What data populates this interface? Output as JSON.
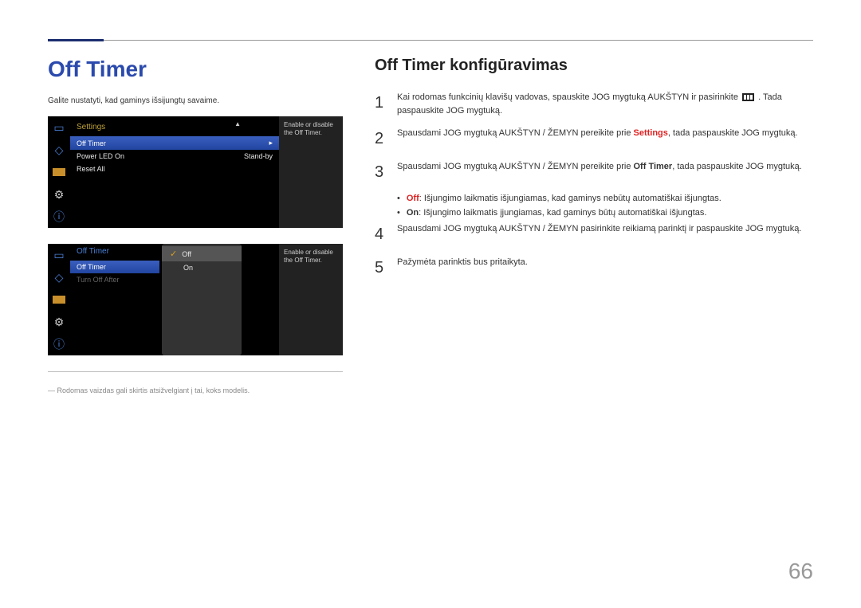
{
  "page_number": "66",
  "left": {
    "title": "Off Timer",
    "desc": "Galite nustatyti, kad gaminys išsijungtų savaime.",
    "note_prefix": "―",
    "note": "Rodomas vaizdas gali skirtis atsižvelgiant į tai, koks modelis."
  },
  "osd1": {
    "title": "Settings",
    "hint_line1": "Enable or disable",
    "hint_line2": "the Off Timer.",
    "rows": [
      {
        "label": "Off Timer",
        "value": "",
        "selected": true,
        "arrow": true
      },
      {
        "label": "Power LED On",
        "value": "Stand-by"
      },
      {
        "label": "Reset All",
        "value": ""
      }
    ]
  },
  "osd2": {
    "title": "Off Timer",
    "hint_line1": "Enable or disable",
    "hint_line2": "the Off Timer.",
    "rows": [
      {
        "label": "Off Timer",
        "selected": true
      },
      {
        "label": "Turn Off After",
        "dim": true
      }
    ],
    "submenu": [
      {
        "label": "Off",
        "checked": true,
        "selected": true
      },
      {
        "label": "On"
      }
    ]
  },
  "right": {
    "title": "Off Timer konfigūravimas",
    "steps": {
      "s1_a": "Kai rodomas funkcinių klavišų vadovas, spauskite JOG mygtuką AUKŠTYN ir pasirinkite",
      "s1_b": ". Tada paspauskite JOG mygtuką.",
      "s2_a": "Spausdami JOG mygtuką AUKŠTYN / ŽEMYN pereikite prie ",
      "s2_hl": "Settings",
      "s2_b": ", tada paspauskite JOG mygtuką.",
      "s3_a": "Spausdami JOG mygtuką AUKŠTYN / ŽEMYN pereikite prie ",
      "s3_hl": "Off Timer",
      "s3_b": ", tada paspauskite JOG mygtuką.",
      "s3_sub_off_hl": "Off",
      "s3_sub_off": ": Išjungimo laikmatis išjungiamas, kad gaminys nebūtų automatiškai išjungtas.",
      "s3_sub_on_hl": "On",
      "s3_sub_on": ": Išjungimo laikmatis įjungiamas, kad gaminys būtų automatiškai išjungtas.",
      "s4": "Spausdami JOG mygtuką AUKŠTYN / ŽEMYN pasirinkite reikiamą parinktį ir paspauskite JOG mygtuką.",
      "s5": "Pažymėta parinktis bus pritaikyta."
    }
  }
}
